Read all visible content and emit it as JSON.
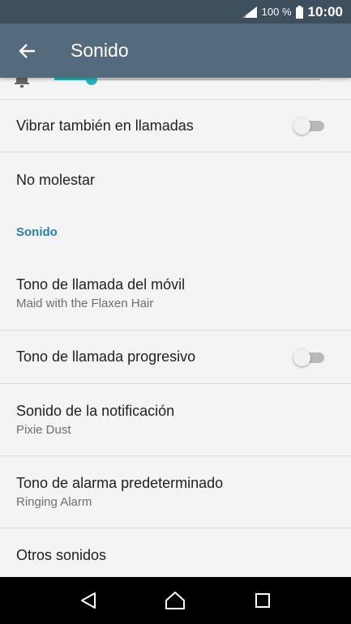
{
  "status_bar": {
    "battery_percent": "100 %",
    "time": "10:00",
    "icons": [
      "signal-icon",
      "battery-icon"
    ]
  },
  "app_bar": {
    "title": "Sonido",
    "back_icon": "back-arrow-icon"
  },
  "volume_slider": {
    "icon": "bell-icon",
    "level": 0.14,
    "accent_color": "#26b3b9"
  },
  "settings": {
    "vibrate": {
      "title": "Vibrar también en llamadas",
      "enabled": false
    },
    "do_not_disturb": {
      "title": "No molestar"
    },
    "section_sound": "Sonido",
    "ringtone": {
      "title": "Tono de llamada del móvil",
      "value": "Maid with the Flaxen Hair"
    },
    "progressive": {
      "title": "Tono de llamada progresivo",
      "enabled": false
    },
    "notification": {
      "title": "Sonido de la notificación",
      "value": "Pixie Dust"
    },
    "alarm": {
      "title": "Tono de alarma predeterminado",
      "value": "Ringing Alarm"
    },
    "other": {
      "title": "Otros sonidos"
    }
  },
  "nav_bar": {
    "icons": [
      "back-triangle-icon",
      "home-icon",
      "recents-icon"
    ]
  },
  "colors": {
    "status_bar": "#3e4f5e",
    "app_bar": "#546a7d",
    "section_header": "#2b7fae",
    "background": "#f4f4f4"
  }
}
